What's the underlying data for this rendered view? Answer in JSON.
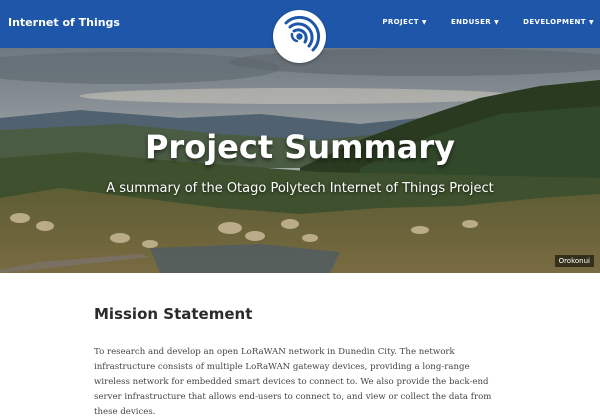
{
  "navbar": {
    "brand": "Internet of Things",
    "items": [
      {
        "label": "PROJECT",
        "caret": "▼"
      },
      {
        "label": "ENDUSER",
        "caret": "▼"
      },
      {
        "label": "DEVELOPMENT",
        "caret": "▼"
      }
    ],
    "logo_icon": "wireless-signal-icon"
  },
  "hero": {
    "title": "Project Summary",
    "subtitle": "A summary of the Otago Polytech Internet of Things Project",
    "photo_credit": "Orokonui"
  },
  "mission": {
    "heading": "Mission Statement",
    "body": "To research and develop an open LoRaWAN network in Dunedin City. The network infrastructure consists of multiple LoRaWAN gateway devices, providing a long-range wireless network for embedded smart devices to connect to. We also provide the back-end server infrastructure that allows end-users to connect to, and view or collect the data from these devices."
  },
  "colors": {
    "navbar": "#1e57aa",
    "logo_arcs": "#1e57aa"
  }
}
